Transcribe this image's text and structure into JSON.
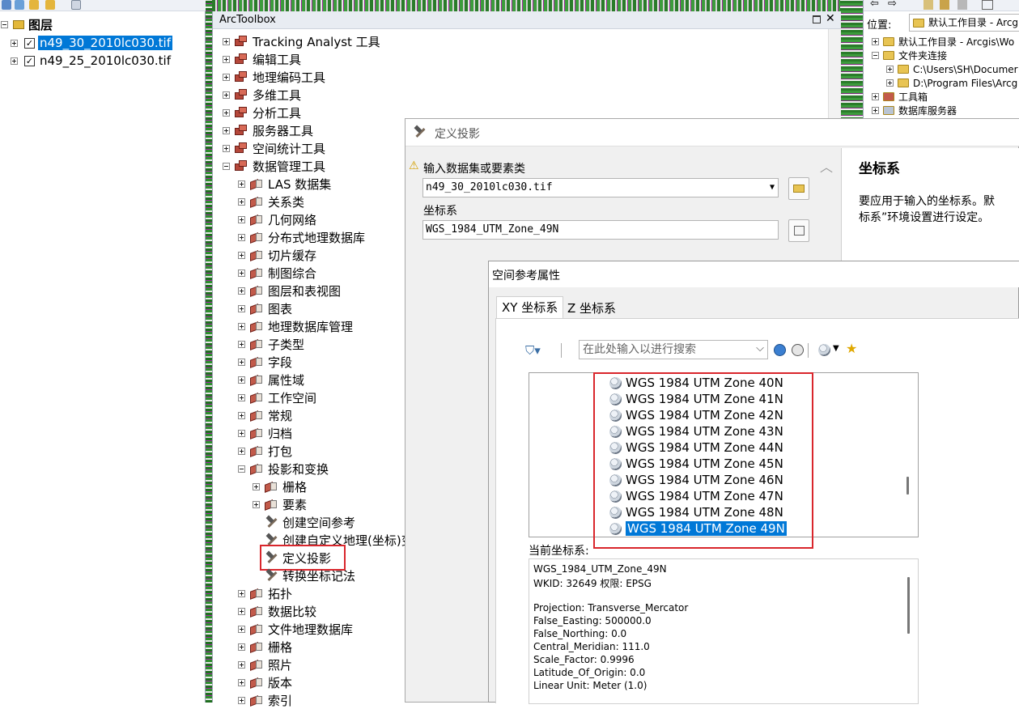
{
  "toc": {
    "title": "图层",
    "layers": [
      {
        "name": "n49_30_2010lc030.tif",
        "checked": true,
        "selected": true
      },
      {
        "name": "n49_25_2010lc030.tif",
        "checked": true,
        "selected": false
      }
    ]
  },
  "toolbox": {
    "title": "ArcToolbox",
    "top_items": [
      "Tracking Analyst 工具",
      "编辑工具",
      "地理编码工具",
      "多维工具",
      "分析工具",
      "服务器工具",
      "空间统计工具",
      "数据管理工具"
    ],
    "data_mgmt_children": [
      "LAS 数据集",
      "关系类",
      "几何网络",
      "分布式地理数据库",
      "切片缓存",
      "制图综合",
      "图层和表视图",
      "图表",
      "地理数据库管理",
      "子类型",
      "字段",
      "属性域",
      "工作空间",
      "常规",
      "归档",
      "打包",
      "投影和变换"
    ],
    "projection_children": [
      "栅格",
      "要素"
    ],
    "projection_tools": [
      "创建空间参考",
      "创建自定义地理(坐标)变",
      "定义投影",
      "转换坐标记法"
    ],
    "after_items": [
      "拓扑",
      "数据比较",
      "文件地理数据库",
      "栅格",
      "照片",
      "版本",
      "索引"
    ]
  },
  "catalog": {
    "location_label": "位置:",
    "location_value": "默认工作目录 - Arcgis\\",
    "items": [
      {
        "label": "默认工作目录 - Arcgis\\Wo",
        "level": 0,
        "expander": "plus"
      },
      {
        "label": "文件夹连接",
        "level": 0,
        "expander": "minus"
      },
      {
        "label": "C:\\Users\\SH\\Documer",
        "level": 1,
        "expander": "plus"
      },
      {
        "label": "D:\\Program Files\\Arcg",
        "level": 1,
        "expander": "plus"
      },
      {
        "label": "工具箱",
        "level": 0,
        "expander": "plus"
      },
      {
        "label": "数据库服务器",
        "level": 0,
        "expander": "plus"
      }
    ]
  },
  "define_projection": {
    "title": "定义投影",
    "input_label": "输入数据集或要素类",
    "input_value": "n49_30_2010lc030.tif",
    "coord_label": "坐标系",
    "coord_value": "WGS_1984_UTM_Zone_49N",
    "help_title": "坐标系",
    "help_line1": "要应用于输入的坐标系。默",
    "help_line2": "标系”环境设置进行设定。"
  },
  "spatial_ref": {
    "title": "空间参考属性",
    "tabs": [
      "XY 坐标系",
      "Z 坐标系"
    ],
    "search_placeholder": "在此处输入以进行搜索",
    "list": [
      "WGS 1984 UTM Zone 40N",
      "WGS 1984 UTM Zone 41N",
      "WGS 1984 UTM Zone 42N",
      "WGS 1984 UTM Zone 43N",
      "WGS 1984 UTM Zone 44N",
      "WGS 1984 UTM Zone 45N",
      "WGS 1984 UTM Zone 46N",
      "WGS 1984 UTM Zone 47N",
      "WGS 1984 UTM Zone 48N",
      "WGS 1984 UTM Zone 49N"
    ],
    "selected_index": 9,
    "current_label": "当前坐标系:",
    "current_lines": [
      "WGS_1984_UTM_Zone_49N",
      "WKID: 32649 权限: EPSG",
      "",
      "Projection: Transverse_Mercator",
      "False_Easting: 500000.0",
      "False_Northing: 0.0",
      "Central_Meridian: 111.0",
      "Scale_Factor: 0.9996",
      "Latitude_Of_Origin: 0.0",
      "Linear Unit: Meter (1.0)"
    ]
  },
  "colors": {
    "selection": "#0078d7",
    "highlight_box": "#d9262c"
  }
}
